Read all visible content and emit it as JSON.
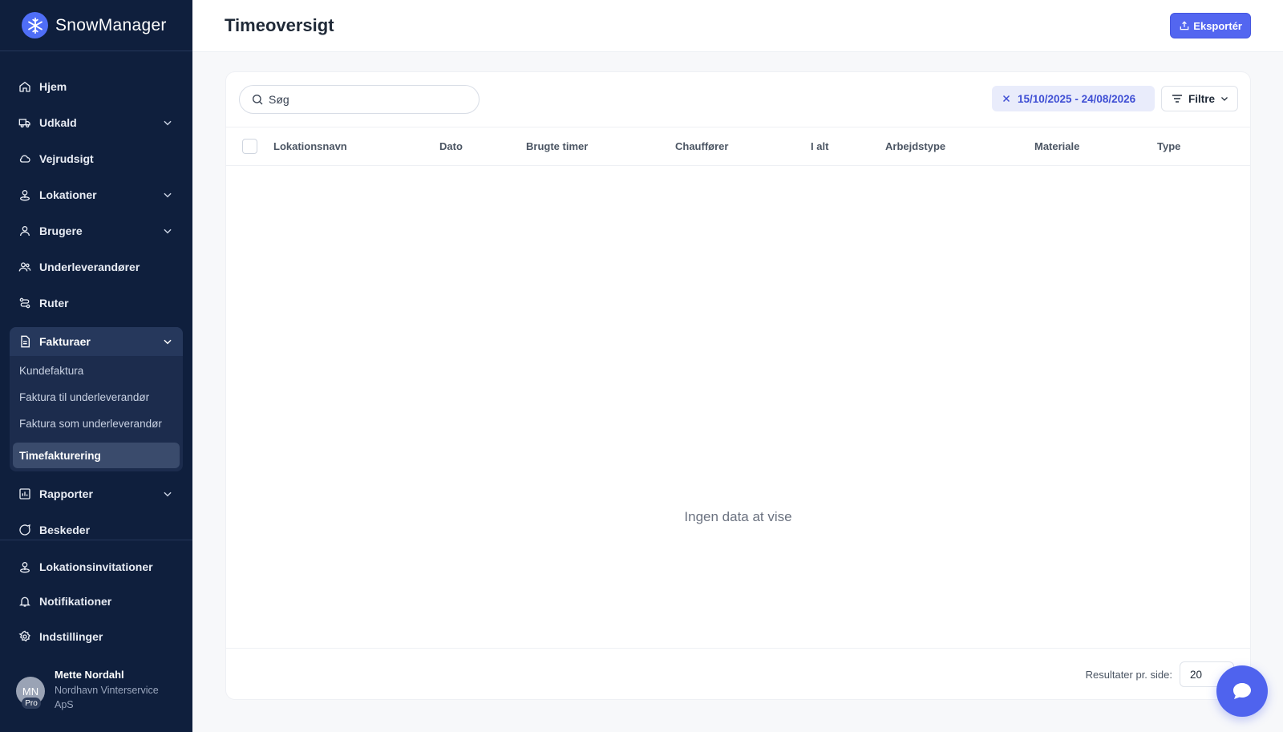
{
  "app": {
    "name": "SnowManager"
  },
  "nav": {
    "items": [
      {
        "label": "Hjem"
      },
      {
        "label": "Udkald"
      },
      {
        "label": "Vejrudsigt"
      },
      {
        "label": "Lokationer"
      },
      {
        "label": "Brugere"
      },
      {
        "label": "Underleverandører"
      },
      {
        "label": "Ruter"
      }
    ],
    "invoices": {
      "label": "Fakturaer",
      "sub": [
        {
          "label": "Kundefaktura"
        },
        {
          "label": "Faktura til underleverandør"
        },
        {
          "label": "Faktura som underleverandør"
        },
        {
          "label": "Timefakturering"
        }
      ]
    },
    "reports": {
      "label": "Rapporter"
    },
    "messages": {
      "label": "Beskeder"
    },
    "bottom": [
      {
        "label": "Lokationsinvitationer"
      },
      {
        "label": "Notifikationer"
      },
      {
        "label": "Indstillinger"
      }
    ]
  },
  "user": {
    "initials": "MN",
    "badge": "Pro",
    "name": "Mette Nordahl",
    "company": "Nordhavn Vinterservice ApS"
  },
  "header": {
    "title": "Timeoversigt",
    "export_label": "Eksportér"
  },
  "toolbar": {
    "search_placeholder": "Søg",
    "date_range": "15/10/2025 - 24/08/2026",
    "filter_label": "Filtre"
  },
  "table": {
    "columns": [
      "Lokationsnavn",
      "Dato",
      "Brugte timer",
      "Chauffører",
      "I alt",
      "Arbejdstype",
      "Materiale",
      "Type"
    ],
    "empty_text": "Ingen data at vise",
    "per_page_label": "Resultater pr. side:",
    "per_page_value": "20"
  },
  "colors": {
    "sidebar": "#0f1f3d",
    "accent": "#5366f0"
  }
}
